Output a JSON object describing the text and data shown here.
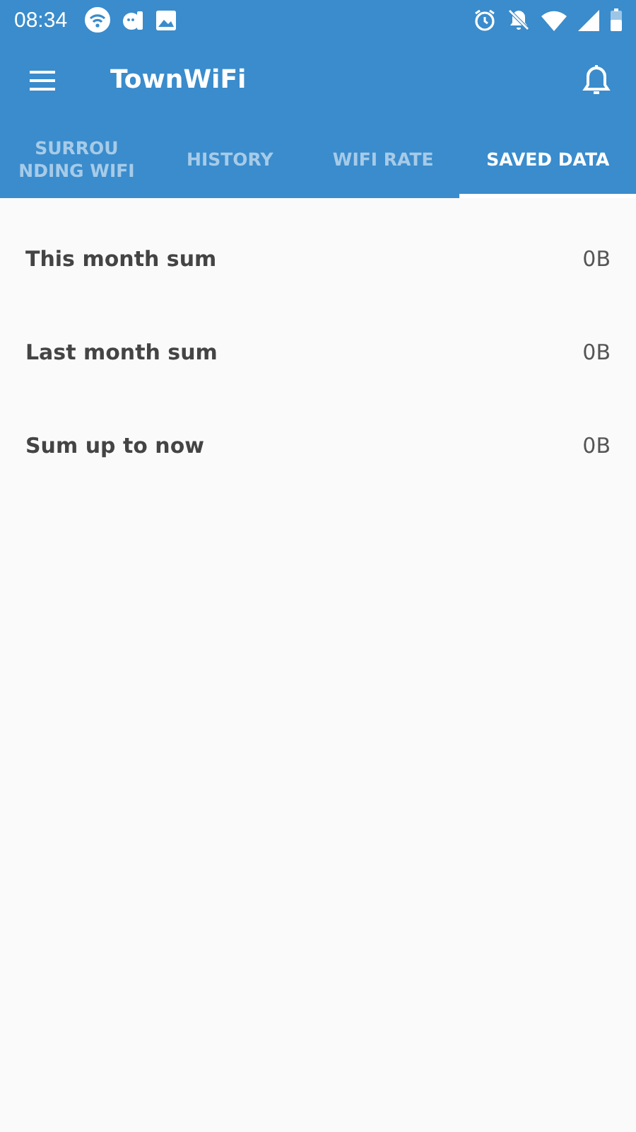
{
  "status_bar": {
    "time": "08:34"
  },
  "app_bar": {
    "title": "TownWiFi"
  },
  "tabs": [
    {
      "label": "SURROU\nNDING WIFI",
      "selected": false
    },
    {
      "label": "HISTORY",
      "selected": false
    },
    {
      "label": "WIFI RATE",
      "selected": false
    },
    {
      "label": "SAVED DATA",
      "selected": true
    }
  ],
  "rows": [
    {
      "label": "This month sum",
      "value": "0B"
    },
    {
      "label": "Last month sum",
      "value": "0B"
    },
    {
      "label": "Sum up to now",
      "value": "0B"
    }
  ]
}
